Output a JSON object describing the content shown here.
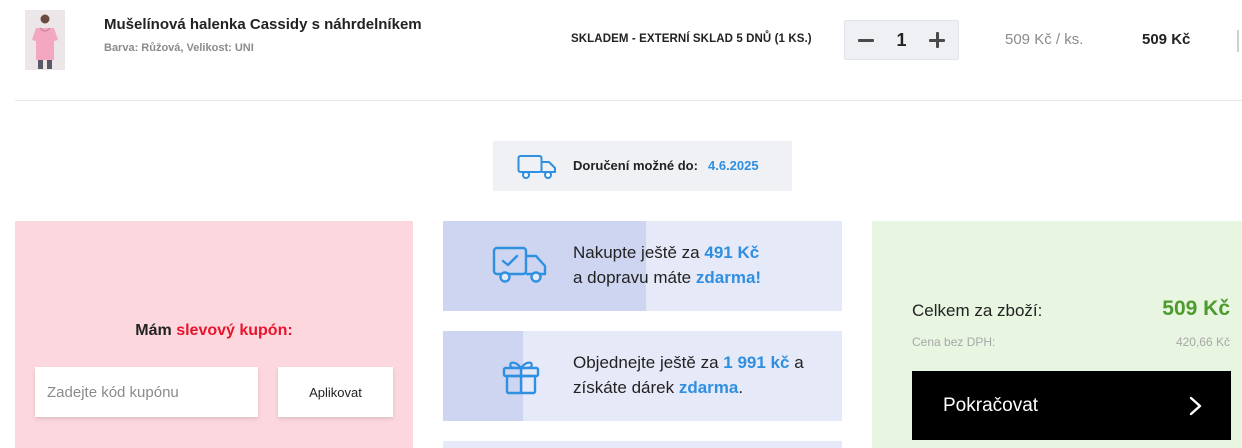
{
  "product": {
    "name": "Mušelínová halenka Cassidy s náhrdelníkem",
    "meta": "Barva: Růžová, Velikost: UNI",
    "stock": "SKLADEM - EXTERNÍ SKLAD 5 DNŮ (1 KS.)",
    "quantity": "1",
    "unit_price": "509 Kč  / ks.",
    "total_price": "509 Kč",
    "image_icon": "product-photo"
  },
  "delivery": {
    "label": "Doručení možné do:",
    "date": "4.6.2025",
    "icon": "truck-icon"
  },
  "coupon": {
    "title_prefix": "Mám",
    "title_accent": "slevový kupón:",
    "placeholder": "Zadejte kód kupónu",
    "apply_label": "Aplikovat"
  },
  "promos": [
    {
      "icon": "delivery-truck-check-icon",
      "line1_prefix": "Nakupte ještě za",
      "line1_amount": "491 Kč",
      "line2_prefix": "a dopravu máte",
      "line2_accent": "zdarma!",
      "progress": 0.51
    },
    {
      "icon": "gift-icon",
      "line1_prefix": "Objednejte ještě za",
      "line1_amount": "1 991 kč",
      "line1_suffix": "a",
      "line2_prefix": "získáte dárek",
      "line2_accent": "zdarma",
      "line2_suffix": ".",
      "progress": 0.2
    }
  ],
  "summary": {
    "label": "Celkem za zboží:",
    "value": "509 Kč",
    "sub_label": "Cena bez DPH:",
    "sub_value": "420,66 Kč",
    "continue_label": "Pokračovat",
    "continue_icon": "chevron-right-icon"
  },
  "colors": {
    "accent_blue": "#2f8fe0",
    "accent_red": "#e8142c",
    "accent_green": "#4e9b2d"
  }
}
